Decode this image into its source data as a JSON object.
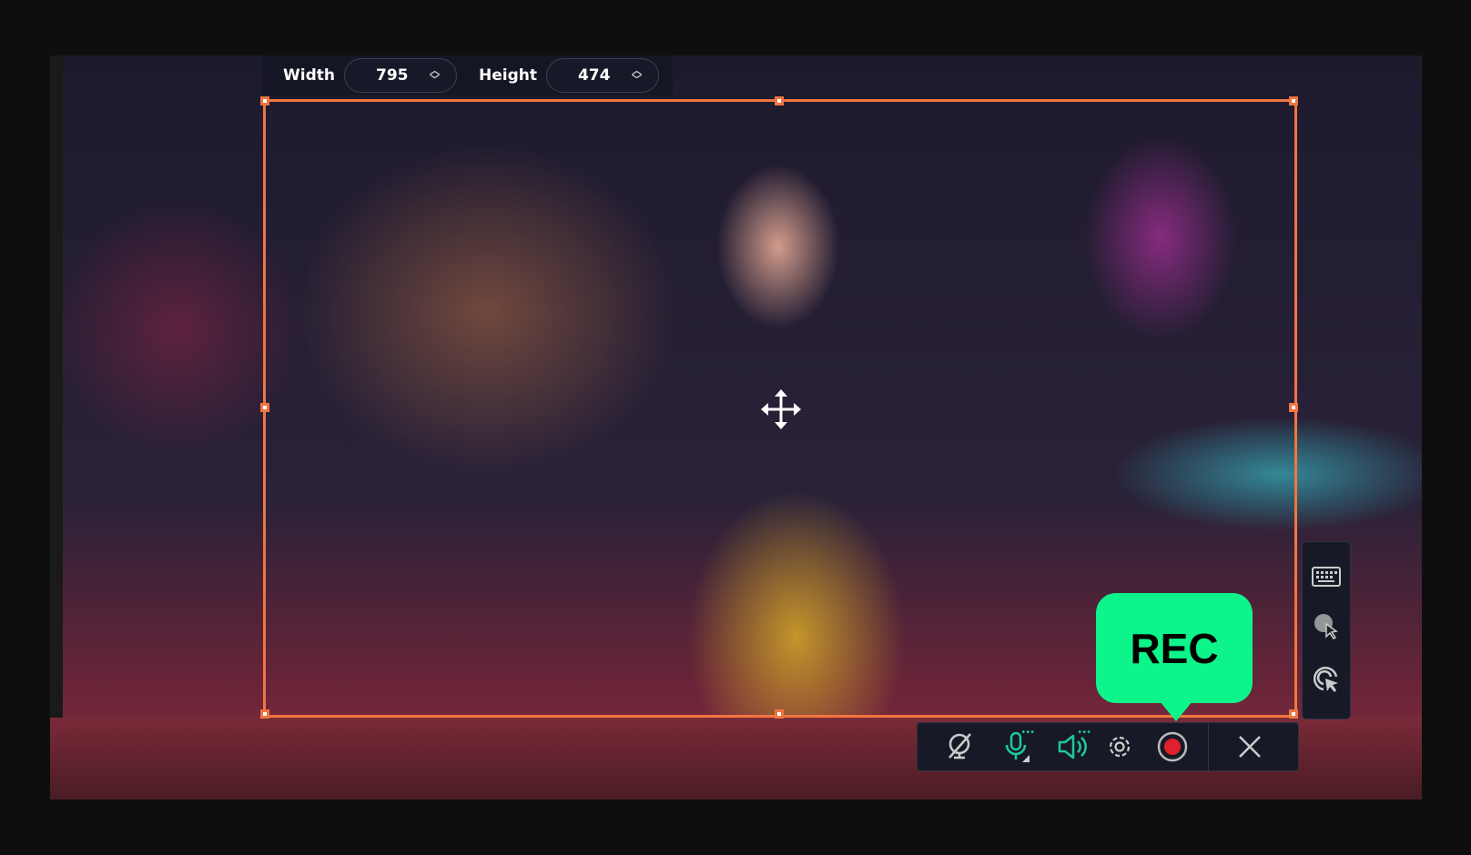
{
  "size_panel": {
    "width_label": "Width",
    "width_value": "795",
    "height_label": "Height",
    "height_value": "474"
  },
  "rec_bubble": {
    "label": "REC",
    "color": "#0df58a"
  },
  "toolbar": {
    "icons": [
      "webcam-off-icon",
      "microphone-icon",
      "speaker-icon",
      "settings-icon",
      "record-icon",
      "close-icon"
    ]
  },
  "side_panel": {
    "icons": [
      "keyboard-icon",
      "cursor-highlight-icon",
      "click-effect-icon"
    ]
  },
  "colors": {
    "selection": "#f0763f",
    "accent": "#1fc99b",
    "record": "#e0202a"
  }
}
